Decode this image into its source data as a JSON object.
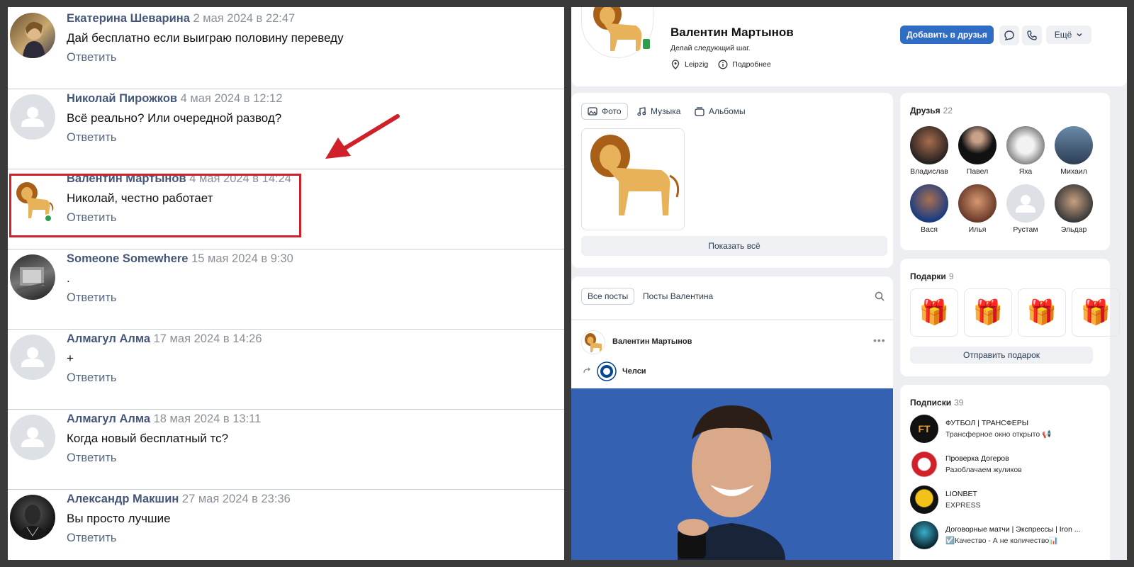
{
  "comments": [
    {
      "author": "Екатерина Шеварина",
      "date": "2 мая 2024 в 22:47",
      "text": "Дай бесплатно если выиграю половину переведу",
      "reply": "Ответить",
      "avatar": "photo"
    },
    {
      "author": "Николай Пирожков",
      "date": "4 мая 2024 в 12:12",
      "text": "Всё реально? Или очередной развод?",
      "reply": "Ответить",
      "avatar": "default"
    },
    {
      "author": "Валентин Мартынов",
      "date": "4 мая 2024 в 14:24",
      "text": "Николай, честно работает",
      "reply": "Ответить",
      "avatar": "lion"
    },
    {
      "author": "Someone Somewhere",
      "date": "15 мая 2024 в 9:30",
      "text": ".",
      "reply": "Ответить",
      "avatar": "photo"
    },
    {
      "author": "Алмагул Алма",
      "date": "17 мая 2024 в 14:26",
      "text": "+",
      "reply": "Ответить",
      "avatar": "default"
    },
    {
      "author": "Алмагул Алма",
      "date": "18 мая 2024 в 13:11",
      "text": "Когда новый бесплатный тс?",
      "reply": "Ответить",
      "avatar": "default"
    },
    {
      "author": "Александр Макшин",
      "date": "27 мая 2024 в 23:36",
      "text": "Вы просто лучшие",
      "reply": "Ответить",
      "avatar": "photo"
    }
  ],
  "profile": {
    "name": "Валентин Мартынов",
    "status": "Делай следующий шаг.",
    "city": "Leipzig",
    "more": "Подробнее",
    "add_friend": "Добавить в друзья",
    "more_button": "Ещё"
  },
  "media": {
    "tabs": [
      "Фото",
      "Музыка",
      "Альбомы"
    ],
    "show_all": "Показать всё"
  },
  "posts": {
    "tabs": [
      "Все посты",
      "Посты Валентина"
    ],
    "author": "Валентин Мартынов",
    "repost_from": "Челси"
  },
  "friends": {
    "title": "Друзья",
    "count": "22",
    "items": [
      "Владислав",
      "Павел",
      "Яха",
      "Михаил",
      "Вася",
      "Илья",
      "Рустам",
      "Эльдар"
    ]
  },
  "gifts": {
    "title": "Подарки",
    "count": "9",
    "send": "Отправить подарок"
  },
  "subscriptions": {
    "title": "Подписки",
    "count": "39",
    "items": [
      {
        "name": "ФУТБОЛ | ТРАНСФЕРЫ",
        "desc": "Трансферное окно открыто 📢"
      },
      {
        "name": "Проверка Догеров",
        "desc": "Разоблачаем жуликов"
      },
      {
        "name": "LIONBET",
        "desc": "EXPRESS"
      },
      {
        "name": "Договорные матчи | Экспрессы | Iron ...",
        "desc": "☑️Качество - А не количество📊"
      }
    ]
  },
  "colors": {
    "accent": "#2f6cc4",
    "highlight": "#d0202a",
    "online": "#2e9e4e"
  }
}
